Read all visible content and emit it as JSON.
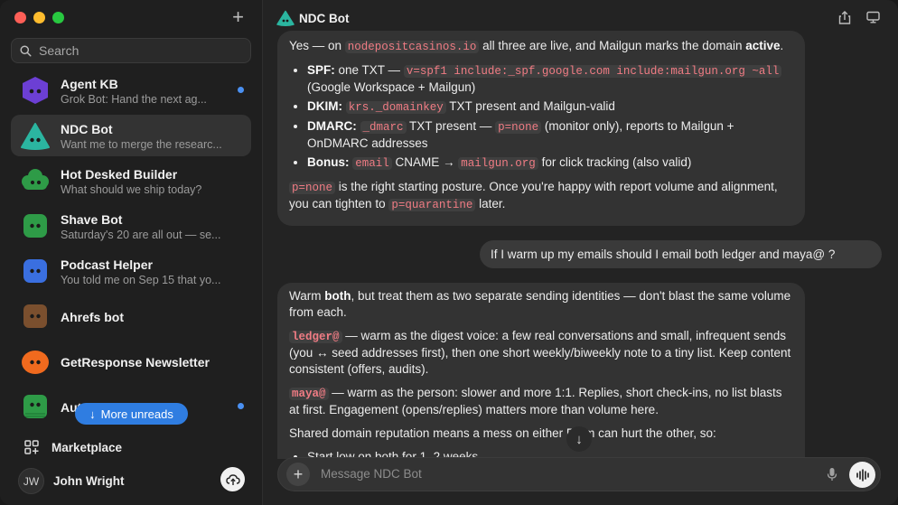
{
  "sidebar": {
    "search_placeholder": "Search",
    "chats": [
      {
        "title": "Agent KB",
        "snippet": "Grok Bot: Hand the next ag...",
        "avatar_color": "#6c3fd4",
        "unread": true
      },
      {
        "title": "NDC Bot",
        "snippet": "Want me to merge the researc...",
        "avatar_color": "#2bb5a0",
        "unread": false,
        "active": true
      },
      {
        "title": "Hot Desked Builder",
        "snippet": "What should we ship today?",
        "avatar_color": "#2e9b47",
        "unread": false
      },
      {
        "title": "Shave Bot",
        "snippet": "Saturday's 20 are all out — se...",
        "avatar_color": "#2e9b47",
        "unread": false
      },
      {
        "title": "Podcast Helper",
        "snippet": "You told me on Sep 15 that yo...",
        "avatar_color": "#3a6fe0",
        "unread": false
      },
      {
        "title": "Ahrefs bot",
        "snippet": "",
        "avatar_color": "#7a4f2e",
        "unread": false
      },
      {
        "title": "GetResponse Newsletter",
        "snippet": "",
        "avatar_color": "#f06a1e",
        "unread": false
      },
      {
        "title": "Aut",
        "snippet": "",
        "avatar_color": "#2e9b47",
        "unread": true
      }
    ],
    "more_unreads_label": "More unreads",
    "marketplace_label": "Marketplace",
    "user_initials": "JW",
    "user_name": "John Wright"
  },
  "header": {
    "title": "NDC Bot"
  },
  "messages": {
    "m1": {
      "p1_a": "Yes — on ",
      "p1_code": "nodepositcasinos.io",
      "p1_b": " all three are live, and Mailgun marks the domain ",
      "p1_bold": "active",
      "p1_c": ".",
      "spf_label": "SPF:",
      "spf_a": " one TXT — ",
      "spf_code": "v=spf1 include:_spf.google.com include:mailgun.org ~all",
      "spf_b": " (Google Workspace + Mailgun)",
      "dkim_label": "DKIM:",
      "dkim_code": "krs._domainkey",
      "dkim_b": " TXT present and Mailgun-valid",
      "dmarc_label": "DMARC:",
      "dmarc_code": "_dmarc",
      "dmarc_b": " TXT present — ",
      "dmarc_code2": "p=none",
      "dmarc_c": " (monitor only), reports to Mailgun + OnDMARC addresses",
      "bonus_label": "Bonus:",
      "bonus_code": "email",
      "bonus_b": " CNAME → ",
      "bonus_code2": "mailgun.org",
      "bonus_c": " for click tracking (also valid)",
      "p2_code": "p=none",
      "p2_a": " is the right starting posture. Once you're happy with report volume and alignment, you can tighten to ",
      "p2_code2": "p=quarantine",
      "p2_b": " later."
    },
    "m2": "If I warm up my emails should I email both ledger and maya@ ?",
    "m3": {
      "p1_a": "Warm ",
      "p1_bold": "both",
      "p1_b": ", but treat them as two separate sending identities — don't blast the same volume from each.",
      "ledger_code": "ledger@",
      "ledger_text": " — warm as the digest voice: a few real conversations and small, infrequent sends (you ↔ seed addresses first), then one short weekly/biweekly note to a tiny list. Keep content consistent (offers, audits).",
      "maya_code": "maya@",
      "maya_text": " — warm as the person: slower and more 1:1. Replies, short check-ins, no list blasts at first. Engagement (opens/replies) matters more than volume here.",
      "p4": "Shared domain reputation means a mess on either From can hurt the other, so:",
      "li1": "Start low on both for 1–2 weeks"
    }
  },
  "composer": {
    "placeholder": "Message NDC Bot"
  },
  "colors": {
    "accent": "#2f7de1",
    "code_text": "#f07c84"
  }
}
